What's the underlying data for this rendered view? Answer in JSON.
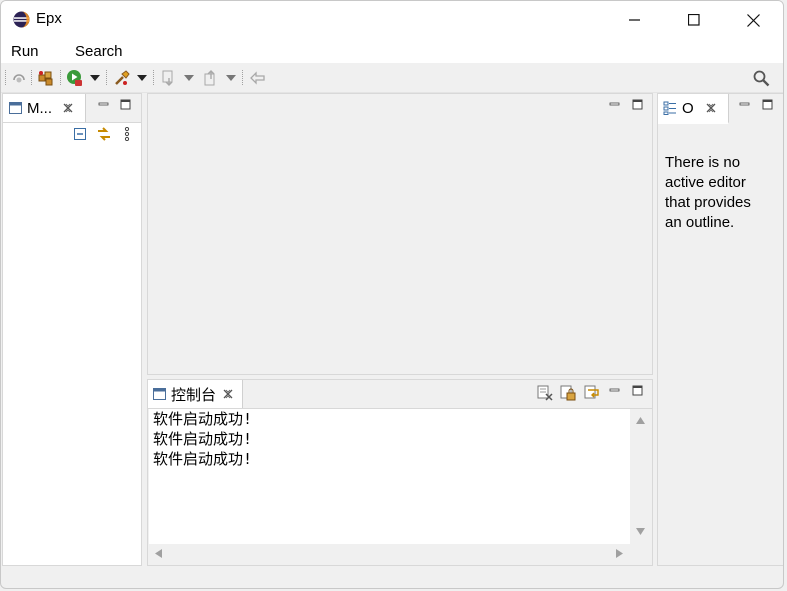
{
  "window": {
    "title": "Epx"
  },
  "menu": {
    "items": [
      "Run",
      "Search"
    ]
  },
  "left_panel": {
    "tab_label": "M..."
  },
  "outline_panel": {
    "tab_label": "O",
    "message": [
      "There is no",
      "active editor",
      "that provides",
      "an outline."
    ]
  },
  "console": {
    "tab_label": "控制台",
    "lines": [
      "软件启动成功!",
      "软件启动成功!",
      "软件启动成功!"
    ]
  },
  "colors": {
    "accent": "#1a58b8",
    "toolbar_green": "#3a9a3a",
    "eclipse_orange": "#e07a00"
  },
  "icons": [
    "eclipse-logo-icon",
    "minimize-window-icon",
    "maximize-window-icon",
    "close-window-icon",
    "skip-breakpoints-icon",
    "new-package-icon",
    "run-icon",
    "external-tools-icon",
    "next-annotation-icon",
    "previous-annotation-icon",
    "last-edit-icon",
    "search-icon"
  ]
}
